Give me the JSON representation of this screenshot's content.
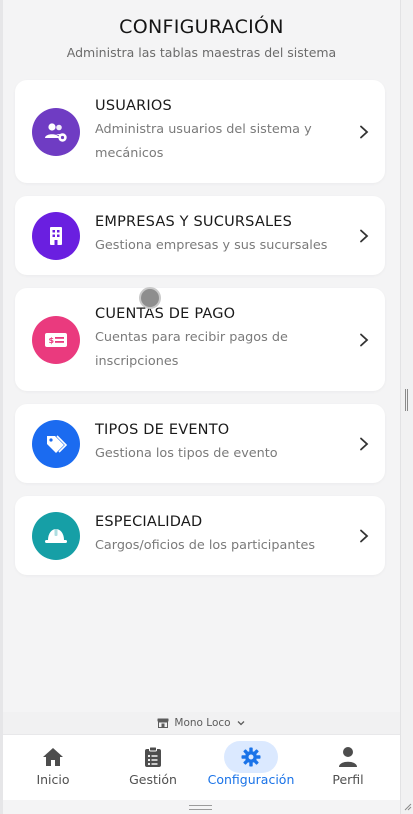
{
  "header": {
    "title": "CONFIGURACIÓN",
    "subtitle": "Administra las tablas maestras del sistema"
  },
  "cards": [
    {
      "title": "USUARIOS",
      "description_line1": "Administra usuarios del sistema y",
      "description_line2": "mecánicos",
      "icon": "users-gear-icon",
      "color": "#6f3cc3"
    },
    {
      "title": "EMPRESAS Y SUCURSALES",
      "description_line1": "Gestiona empresas y sus sucursales",
      "icon": "building-icon",
      "color": "#6a1fe0"
    },
    {
      "title": "CUENTAS DE PAGO",
      "description_line1": "Cuentas para recibir pagos de",
      "description_line2": "inscripciones",
      "icon": "money-card-icon",
      "color": "#ea3a7e"
    },
    {
      "title": "TIPOS DE EVENTO",
      "description_line1": "Gestiona los tipos de evento",
      "icon": "tags-icon",
      "color": "#1b6bf0"
    },
    {
      "title": "ESPECIALIDAD",
      "description_line1": "Cargos/oficios de los participantes",
      "icon": "hard-hat-icon",
      "color": "#169fa6"
    }
  ],
  "tenant": {
    "name": "Mono Loco",
    "icon": "store-icon"
  },
  "tabs": [
    {
      "label": "Inicio",
      "icon": "home-icon",
      "active": false
    },
    {
      "label": "Gestión",
      "icon": "clipboard-list-icon",
      "active": false
    },
    {
      "label": "Configuración",
      "icon": "gear-icon",
      "active": true
    },
    {
      "label": "Perfil",
      "icon": "user-icon",
      "active": false
    }
  ],
  "colors": {
    "accent": "#1a73e8",
    "active_tab_bg": "#dbe9ff",
    "background": "#f4f4f5"
  }
}
